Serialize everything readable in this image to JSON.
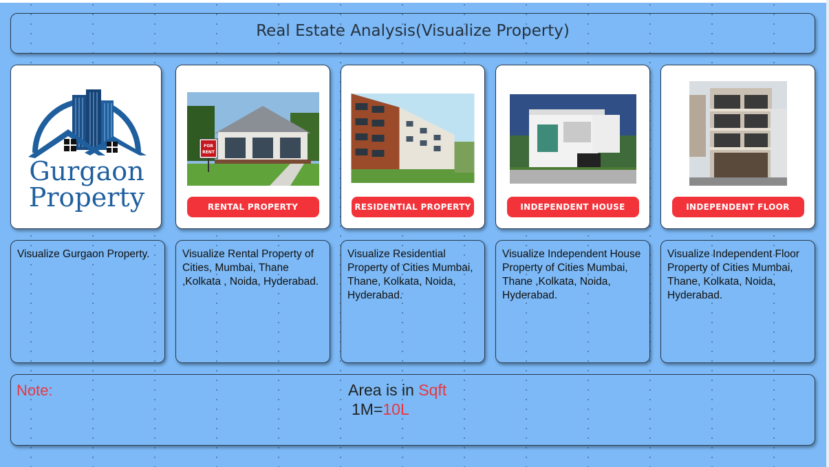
{
  "title": "Real Estate Analysis(Visualize Property)",
  "cards": [
    {
      "logo_line1": "Gurgaon",
      "logo_line2": "Property",
      "description": "Visualize Gurgaon Property."
    },
    {
      "tag": "RENTAL PROPERTY",
      "sign": "FOR RENT",
      "description": "Visualize Rental Property of Cities, Mumbai, Thane ,Kolkata , Noida, Hyderabad."
    },
    {
      "tag": "RESIDENTIAL PROPERTY",
      "description": "Visualize Residential Property of Cities Mumbai, Thane, Kolkata, Noida, Hyderabad."
    },
    {
      "tag": "INDEPENDENT HOUSE",
      "description": "Visualize Independent House Property of Cities Mumbai, Thane ,Kolkata, Noida, Hyderabad."
    },
    {
      "tag": "INDEPENDENT FLOOR",
      "description": "Visualize Independent Floor Property of Cities Mumbai, Thane, Kolkata, Noida, Hyderabad."
    }
  ],
  "note": {
    "label": "Note:",
    "area_prefix": "Area is in ",
    "area_unit": "Sqft",
    "conv_prefix": "1M=",
    "conv_value": "10L"
  },
  "colors": {
    "background": "#7cb9f6",
    "tag_red": "#f3333a",
    "accent_red": "#e8373f",
    "logo_blue": "#1f5f9e"
  }
}
